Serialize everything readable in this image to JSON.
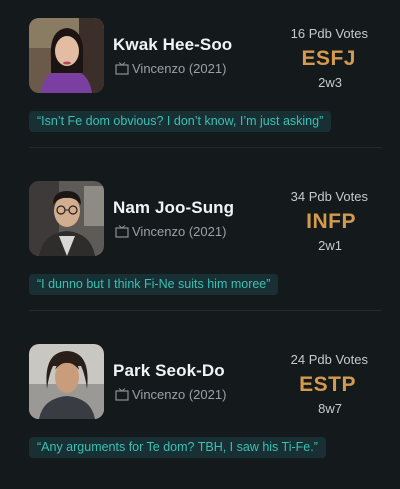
{
  "cards": [
    {
      "name": "Kwak Hee-Soo",
      "source": "Vincenzo (2021)",
      "votes": "16 Pdb Votes",
      "type": "ESFJ",
      "enneagram": "2w3",
      "comment": "“Isn’t Fe dom obvious? I don’t know, I’m just asking”"
    },
    {
      "name": "Nam Joo-Sung",
      "source": "Vincenzo (2021)",
      "votes": "34 Pdb Votes",
      "type": "INFP",
      "enneagram": "2w1",
      "comment": "“I dunno but I think Fi-Ne suits him moree”"
    },
    {
      "name": "Park Seok-Do",
      "source": "Vincenzo (2021)",
      "votes": "24 Pdb Votes",
      "type": "ESTP",
      "enneagram": "8w7",
      "comment": "“Any arguments for Te dom? TBH, I saw his Ti-Fe.”"
    }
  ],
  "icons": {
    "source": "tv-icon"
  },
  "colors": {
    "background": "#14191c",
    "type": "#d49a4e",
    "comment_text": "#3ac0b4",
    "comment_bg": "#183033"
  }
}
